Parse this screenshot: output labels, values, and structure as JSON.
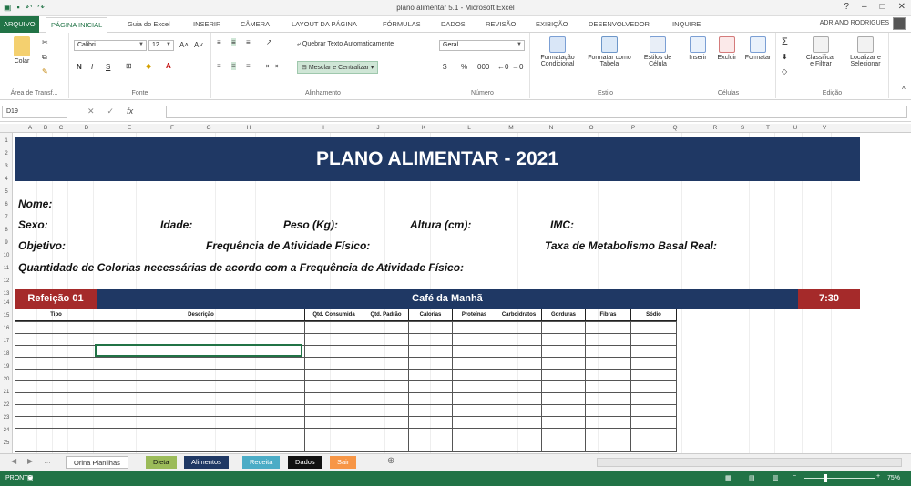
{
  "window": {
    "title": "plano alimentar 5.1 - Microsoft Excel",
    "user": "ADRIANO RODRIGUES"
  },
  "tabs": [
    "ARQUIVO",
    "PÁGINA INICIAL",
    "Guia do Excel",
    "INSERIR",
    "CÂMERA",
    "LAYOUT DA PÁGINA",
    "FÓRMULAS",
    "DADOS",
    "REVISÃO",
    "EXIBIÇÃO",
    "DESENVOLVEDOR",
    "INQUIRE"
  ],
  "ribbon": {
    "paste": "Colar",
    "clipboard_group": "Área de Transf...",
    "font_name": "Calibri",
    "font_size": "12",
    "font_group": "Fonte",
    "wrap_text": "Quebrar Texto Automaticamente",
    "merge_center": "Mesclar e Centralizar",
    "alignment_group": "Alinhamento",
    "number_format": "Geral",
    "number_group": "Número",
    "conditional": [
      "Formatação",
      "Condicional"
    ],
    "format_table": [
      "Formatar como",
      "Tabela"
    ],
    "cell_styles": [
      "Estilos de",
      "Célula"
    ],
    "styles_group": "Estilo",
    "insert": "Inserir",
    "delete": "Excluir",
    "format": "Formatar",
    "cells_group": "Células",
    "sort_filter": [
      "Classificar",
      "e Filtrar"
    ],
    "find_select": [
      "Localizar e",
      "Selecionar"
    ],
    "editing_group": "Edição"
  },
  "formula_bar": {
    "name_box": "D19"
  },
  "columns": [
    "A",
    "B",
    "C",
    "D",
    "E",
    "F",
    "G",
    "H",
    "I",
    "J",
    "K",
    "L",
    "M",
    "N",
    "O",
    "P",
    "Q",
    "R",
    "S",
    "T",
    "U",
    "V"
  ],
  "rows": [
    "1",
    "2",
    "3",
    "4",
    "5",
    "6",
    "7",
    "8",
    "9",
    "10",
    "11",
    "12",
    "13",
    "14",
    "15",
    "16",
    "17",
    "18",
    "19",
    "20",
    "21",
    "22",
    "23",
    "24",
    "25",
    "26"
  ],
  "sheet": {
    "title": "PLANO ALIMENTAR - 2021",
    "labels": {
      "nome": "Nome:",
      "sexo": "Sexo:",
      "idade": "Idade:",
      "peso": "Peso (Kg):",
      "altura": "Altura (cm):",
      "imc": "IMC:",
      "objetivo": "Objetivo:",
      "frequencia": "Frequência de Atividade Físico:",
      "taxa": "Taxa de Metabolismo Basal Real:",
      "calorias": "Quantidade de Colorias necessárias de acordo com a Frequência de Atividade Físico:"
    },
    "meal": {
      "number": "Refeição 01",
      "name": "Café da Manhã",
      "time": "7:30"
    },
    "table_headers": [
      "Tipo",
      "Descrição",
      "Qtd. Consumida",
      "Qtd. Padrão",
      "Calorias",
      "Proteínas",
      "Carboidratos",
      "Gorduras",
      "Fibras",
      "Sódio"
    ]
  },
  "sheet_tabs": [
    {
      "label": "Orina Planilhas",
      "color": "#ffffff"
    },
    {
      "label": "Dieta",
      "color": "#9bbb59"
    },
    {
      "label": "Alimentos",
      "color": "#1f3864"
    },
    {
      "label": "Receita",
      "color": "#4bacc6"
    },
    {
      "label": "Dados",
      "color": "#111111"
    },
    {
      "label": "Sair",
      "color": "#f79646"
    }
  ],
  "status": {
    "left": "PRONTO",
    "zoom": "75%"
  },
  "colors": {
    "excel_green": "#217346",
    "navy": "#1f3864",
    "red": "#a52a2a"
  }
}
